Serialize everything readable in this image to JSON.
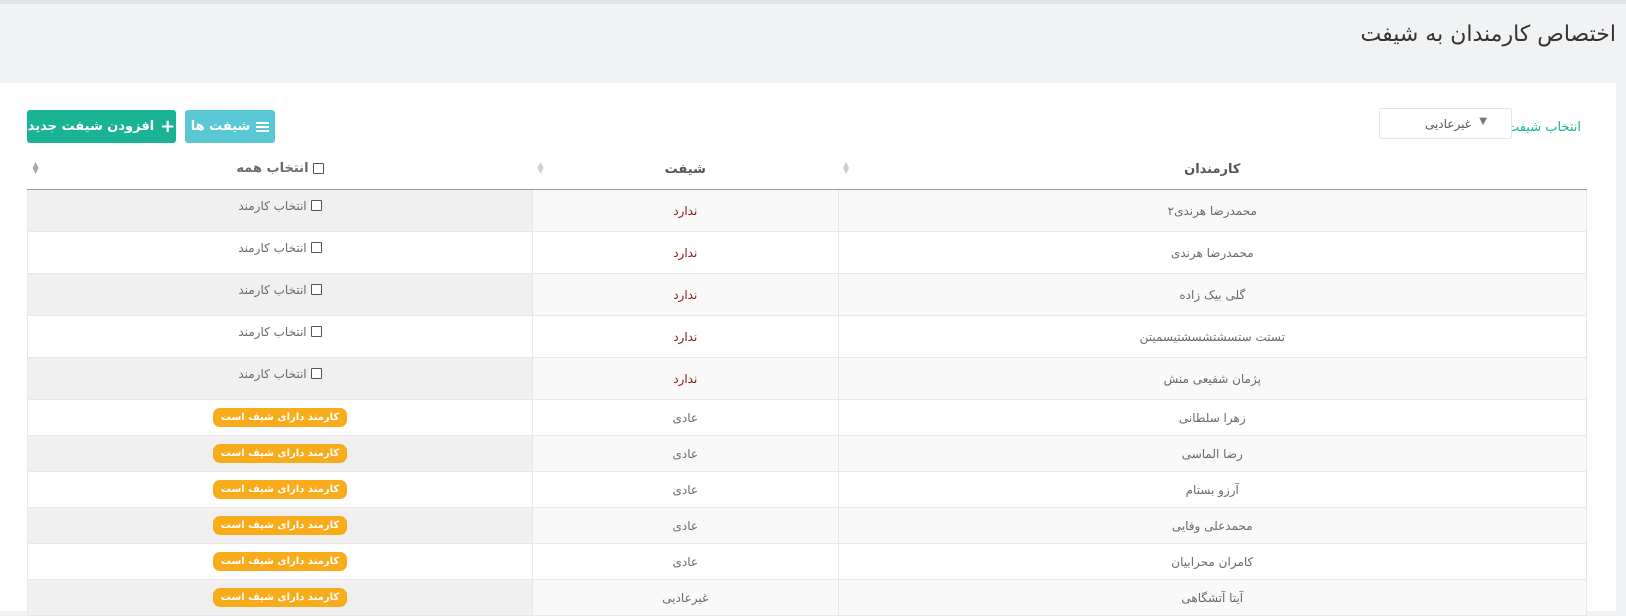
{
  "page": {
    "title": "اختصاص کارمندان به شیفت"
  },
  "filter": {
    "label": "انتخاب شیفت",
    "selected": "غیرعادیی"
  },
  "buttons": {
    "add_shift": "افزودن شیفت جدید",
    "shifts": "شیفت ها"
  },
  "table": {
    "headers": {
      "employees": "کارمندان",
      "shift": "شیفت",
      "select_all": "انتخاب همه"
    },
    "select_employee_label": "انتخاب کارمند",
    "has_shift_badge": "کارمند دارای شیف است",
    "rows": [
      {
        "employee": "محمدرضا هرندی۲",
        "shift": "ندارد"
      },
      {
        "employee": "محمدرضا هرندی",
        "shift": "ندارد"
      },
      {
        "employee": "گلی بیک زاده",
        "shift": "ندارد"
      },
      {
        "employee": "تستت ستسشتشسشتیسمیتن",
        "shift": "ندارد"
      },
      {
        "employee": "پژمان شفیعی منش",
        "shift": "ندارد"
      },
      {
        "employee": "زهرا سلطانی",
        "shift": "عادی"
      },
      {
        "employee": "رضا الماسی",
        "shift": "عادی"
      },
      {
        "employee": "آرزو بستام",
        "shift": "عادی"
      },
      {
        "employee": "محمدعلی وفایی",
        "shift": "عادی"
      },
      {
        "employee": "کامران محرابیان",
        "shift": "عادی"
      },
      {
        "employee": "آیتا آتشگاهی",
        "shift": "غیرعادیی"
      }
    ]
  }
}
